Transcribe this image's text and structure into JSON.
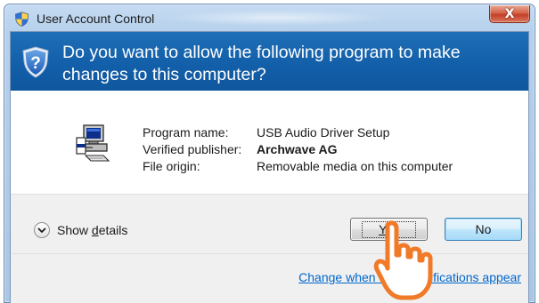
{
  "window": {
    "title": "User Account Control",
    "close_glyph": "X",
    "title_icon": "uac-shield-icon"
  },
  "header": {
    "question": "Do you want to allow the following program to make changes to this computer?",
    "icon": "shield-question-icon",
    "band_color": "#1466b0"
  },
  "program": {
    "icon": "setup-program-icon",
    "rows": [
      {
        "label": "Program name:",
        "value": "USB Audio Driver Setup",
        "bold": false
      },
      {
        "label": "Verified publisher:",
        "value": "Archwave AG",
        "bold": true
      },
      {
        "label": "File origin:",
        "value": "Removable media on this computer",
        "bold": false
      }
    ]
  },
  "footer": {
    "show_details_prefix": "Show ",
    "show_details_accel": "d",
    "show_details_suffix": "etails",
    "yes_accel": "Y",
    "yes_rest": "es",
    "no_label": "No",
    "change_link": "Change when these notifications appear",
    "link_color": "#0066cc"
  },
  "cursor": {
    "icon": "hand-pointer-cursor-icon"
  }
}
